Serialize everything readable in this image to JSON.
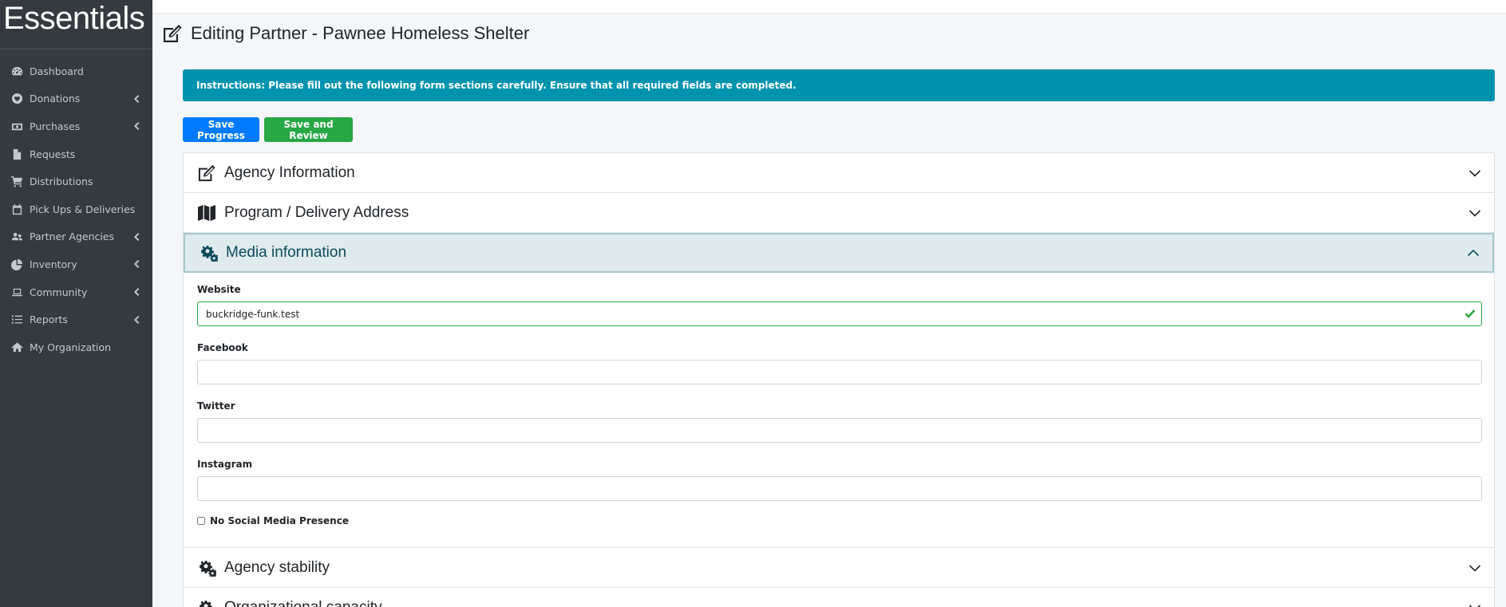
{
  "brand": {
    "text": "Essentials"
  },
  "sidebar": {
    "items": [
      {
        "label": "Dashboard",
        "icon": "tachometer-icon",
        "has_caret": false
      },
      {
        "label": "Donations",
        "icon": "heart-circle-icon",
        "has_caret": true
      },
      {
        "label": "Purchases",
        "icon": "money-bill-icon",
        "has_caret": true
      },
      {
        "label": "Requests",
        "icon": "file-icon",
        "has_caret": false
      },
      {
        "label": "Distributions",
        "icon": "shopping-cart-icon",
        "has_caret": false
      },
      {
        "label": "Pick Ups & Deliveries",
        "icon": "calendar-icon",
        "has_caret": false
      },
      {
        "label": "Partner Agencies",
        "icon": "users-icon",
        "has_caret": true
      },
      {
        "label": "Inventory",
        "icon": "pie-chart-icon",
        "has_caret": true
      },
      {
        "label": "Community",
        "icon": "laptop-icon",
        "has_caret": true
      },
      {
        "label": "Reports",
        "icon": "list-icon",
        "has_caret": true
      },
      {
        "label": "My Organization",
        "icon": "home-icon",
        "has_caret": false
      }
    ]
  },
  "page": {
    "title": "Editing Partner - Pawnee Homeless Shelter"
  },
  "alert": {
    "text": "Instructions: Please fill out the following form sections carefully. Ensure that all required fields are completed."
  },
  "buttons": {
    "save_progress": "Save Progress",
    "save_and_review": "Save and Review"
  },
  "sections": {
    "agency_information": "Agency Information",
    "program_address": "Program / Delivery Address",
    "media_information": "Media information",
    "agency_stability": "Agency stability",
    "organizational_capacity": "Organizational capacity"
  },
  "media_form": {
    "website": {
      "label": "Website",
      "value": "buckridge-funk.test"
    },
    "facebook": {
      "label": "Facebook",
      "value": ""
    },
    "twitter": {
      "label": "Twitter",
      "value": ""
    },
    "instagram": {
      "label": "Instagram",
      "value": ""
    },
    "no_social": {
      "label": "No Social Media Presence",
      "checked": false
    }
  },
  "colors": {
    "sidebar_bg": "#343a40",
    "alert_bg": "#0093ae",
    "primary": "#007bff",
    "success": "#28a745",
    "active_section_bg": "#e0ebef"
  }
}
